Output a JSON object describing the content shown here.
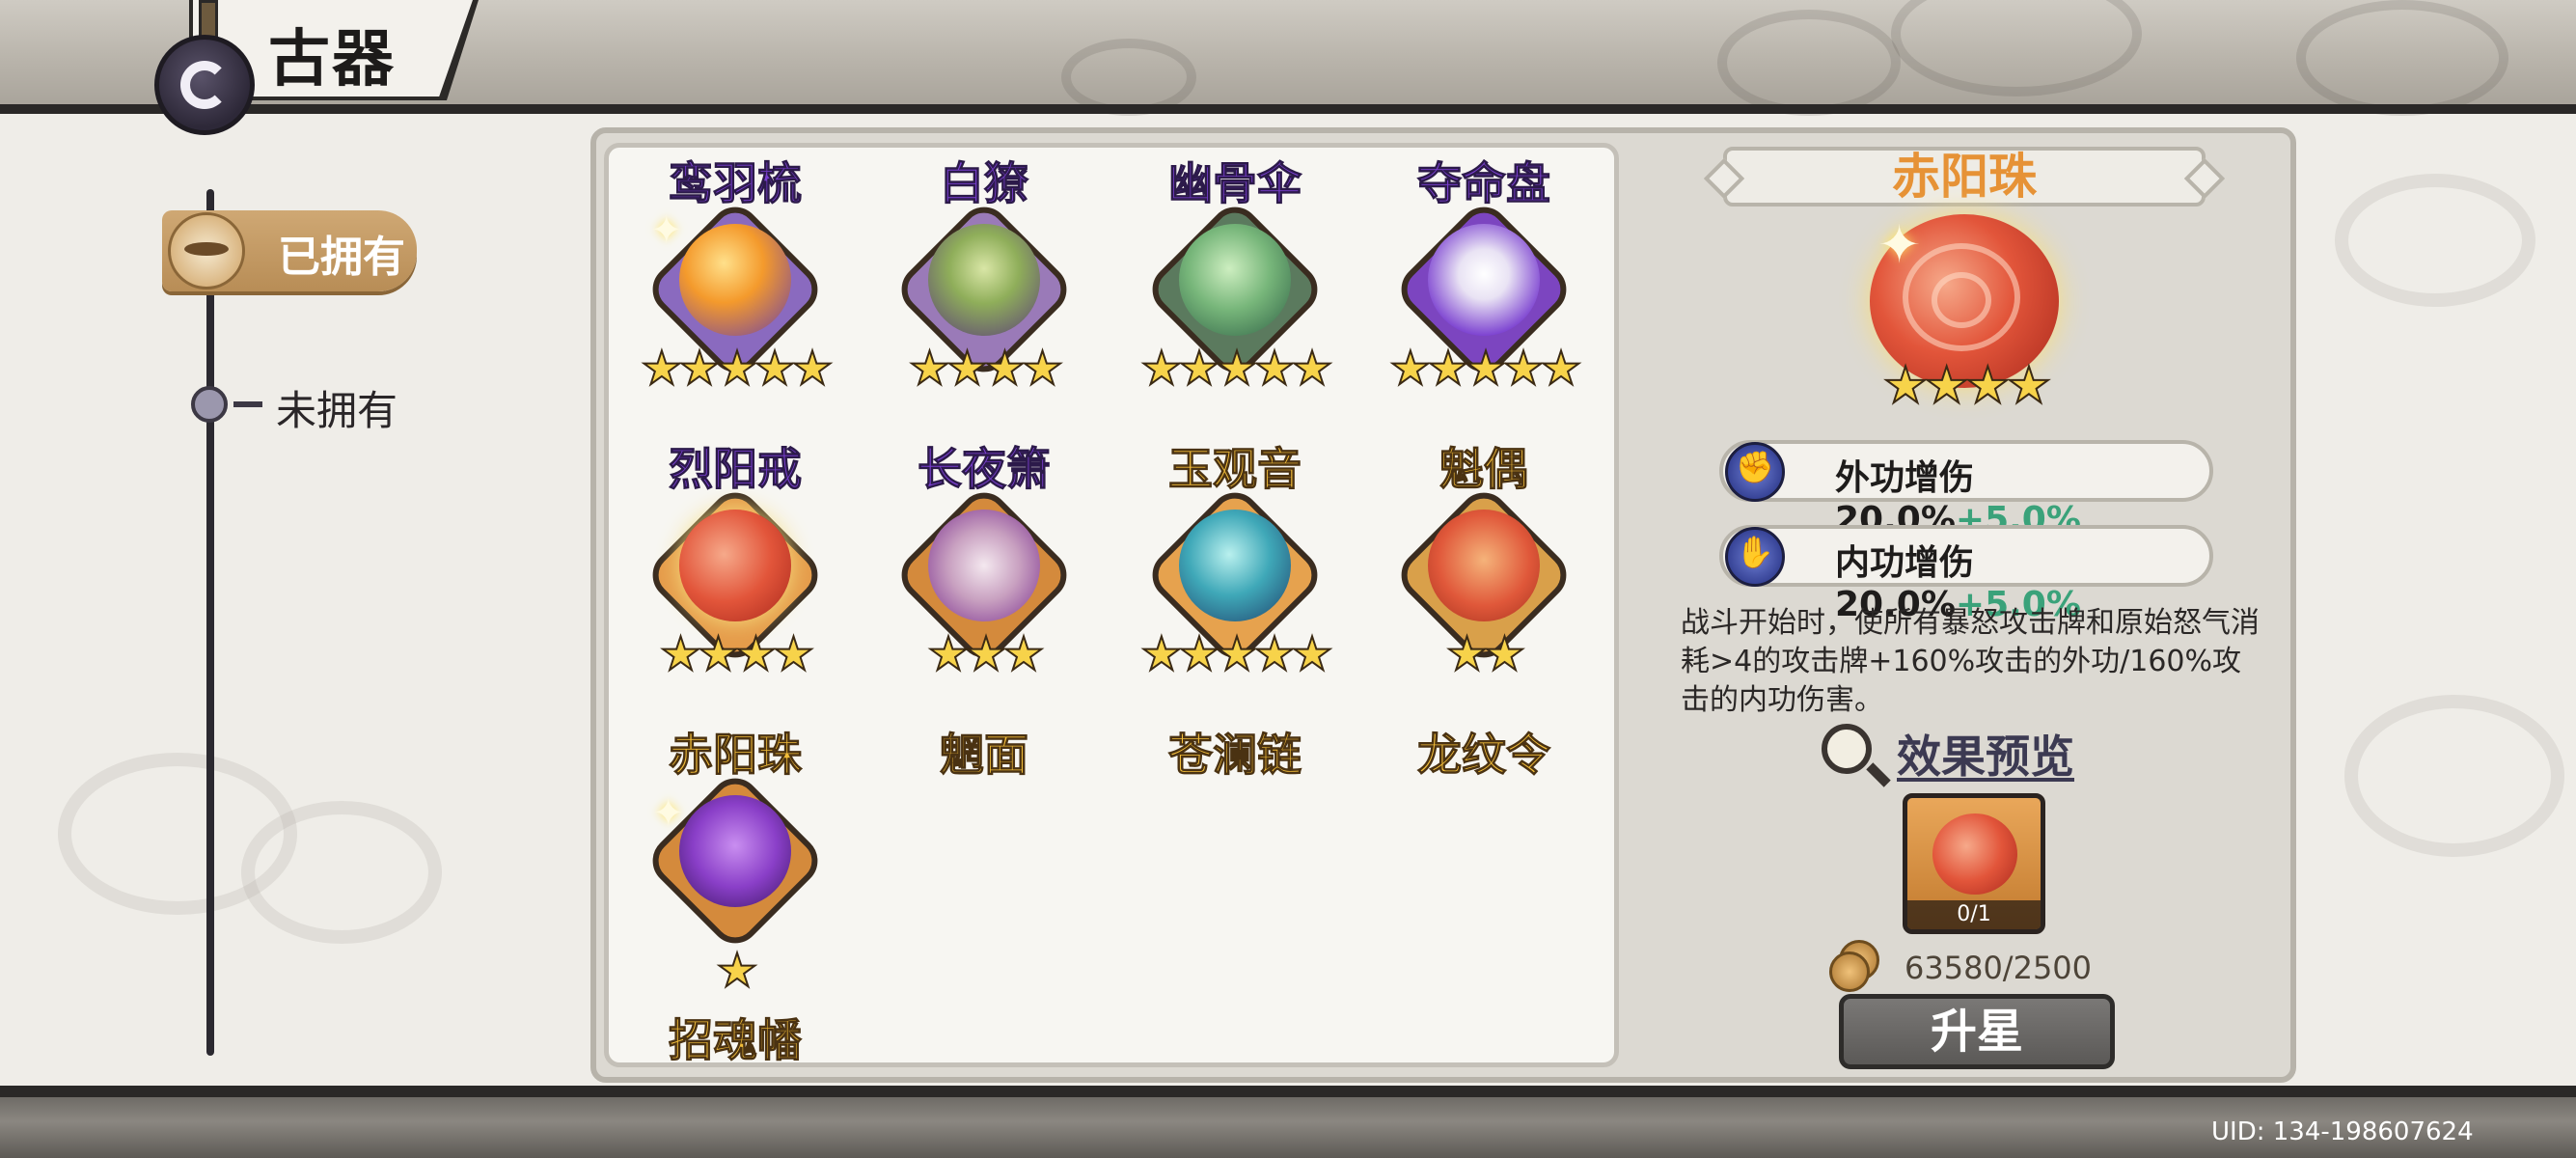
{
  "header": {
    "title": "古器"
  },
  "sidebar": {
    "tabs": [
      {
        "label": "已拥有",
        "selected": true
      },
      {
        "label": "未拥有",
        "selected": false
      }
    ]
  },
  "items": [
    {
      "name": "鸾羽梳",
      "stars": "★★★★★",
      "name_color": "purple"
    },
    {
      "name": "白獠",
      "stars": "★★★★",
      "name_color": "purple"
    },
    {
      "name": "幽骨伞",
      "stars": "★★★★★",
      "name_color": "purple"
    },
    {
      "name": "夺命盘",
      "stars": "★★★★★",
      "name_color": "purple"
    },
    {
      "name": "烈阳戒",
      "stars": "★★★★",
      "name_color": "purple"
    },
    {
      "name": "长夜箫",
      "stars": "★★★",
      "name_color": "purple"
    },
    {
      "name": "玉观音",
      "stars": "★★★★★",
      "name_color": "gold"
    },
    {
      "name": "魁偶",
      "stars": "★★",
      "name_color": "gold"
    },
    {
      "name": "赤阳珠",
      "stars": "",
      "name_color": "gold"
    },
    {
      "name": "魍面",
      "stars": "",
      "name_color": "gold"
    },
    {
      "name": "苍澜链",
      "stars": "",
      "name_color": "gold"
    },
    {
      "name": "龙纹令",
      "stars": "",
      "name_color": "gold"
    },
    {
      "name": "招魂幡",
      "stars": "★",
      "name_color": "gold"
    }
  ],
  "detail": {
    "name": "赤阳珠",
    "stars": "★★★★",
    "stats": [
      {
        "label": "外功增伤",
        "value": "20.0%",
        "bonus": "+5.0%",
        "icon": "fist-icon"
      },
      {
        "label": "内功增伤",
        "value": "20.0%",
        "bonus": "+5.0%",
        "icon": "palm-icon"
      }
    ],
    "description": "战斗开始时，使所有暴怒攻击牌和原始怒气消耗>4的攻击牌+160%攻击的外功/160%攻击的内功伤害。",
    "preview_label": "效果预览",
    "preview_count": "0/1",
    "cost": "63580/2500",
    "upgrade_label": "升星"
  },
  "footer": {
    "uid": "UID: 134-198607624"
  },
  "colors": {
    "accent_orange": "#e69236",
    "bonus_green": "#3aa27a",
    "name_purple": "#7a3fd0",
    "name_gold": "#f2bd3a",
    "star_yellow": "#f7d34a"
  }
}
